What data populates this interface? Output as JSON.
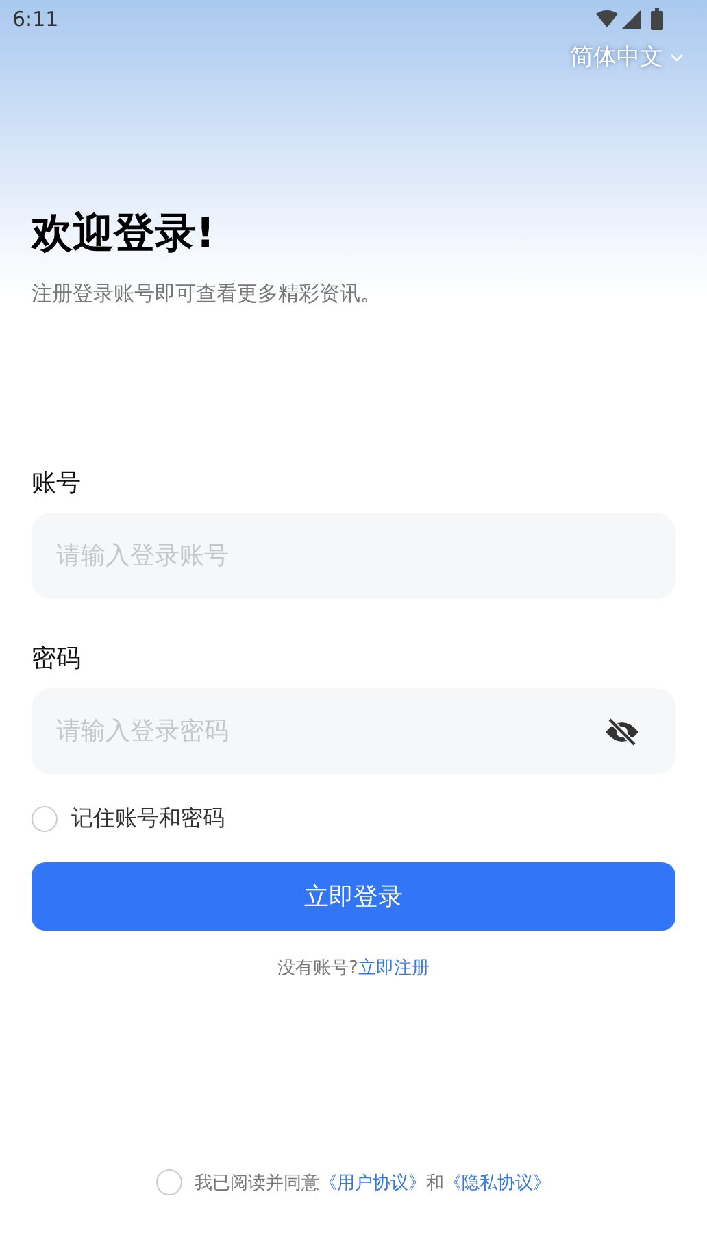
{
  "status_bar": {
    "time": "6:11"
  },
  "language": {
    "label": "简体中文"
  },
  "header": {
    "title": "欢迎登录!",
    "subtitle": "注册登录账号即可查看更多精彩资讯。"
  },
  "account": {
    "label": "账号",
    "placeholder": "请输入登录账号"
  },
  "password": {
    "label": "密码",
    "placeholder": "请输入登录密码",
    "visible": false
  },
  "remember": {
    "label": "记住账号和密码",
    "checked": false
  },
  "login_button": "立即登录",
  "register": {
    "prompt": "没有账号?",
    "link": "立即注册"
  },
  "agreement": {
    "checked": false,
    "text": "我已阅读并同意",
    "user_link": "《用户协议》",
    "and": "和",
    "privacy_link": "《隐私协议》"
  }
}
